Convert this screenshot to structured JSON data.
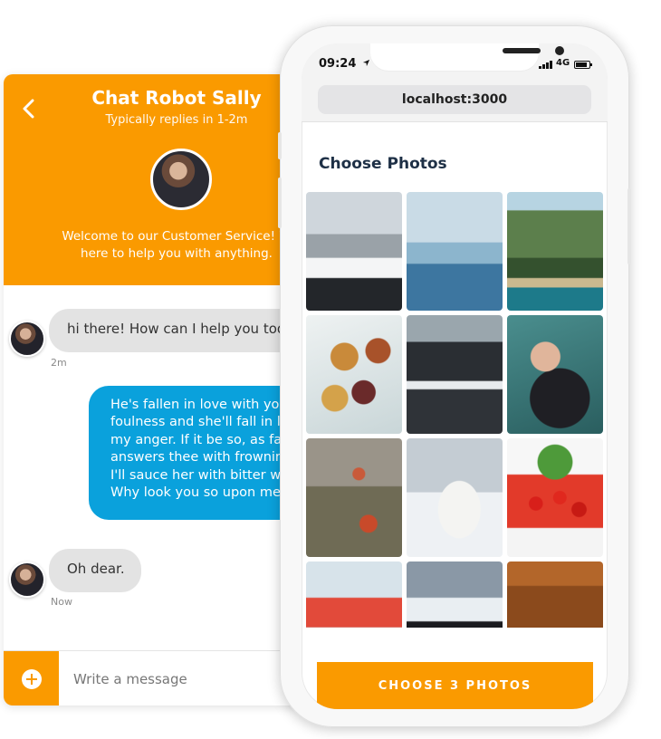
{
  "chat": {
    "title": "Chat Robot Sally",
    "subtitle": "Typically replies in 1-2m",
    "welcome": "Welcome to our Customer Service! W\nhere to help you with anything.",
    "messages": [
      {
        "from": "bot",
        "text": "hi there! How can I help you toda",
        "time": "2m"
      },
      {
        "from": "user",
        "text": "He's fallen in love with you\nfoulness and she'll fall in l\nmy anger. If it be so, as fas\nanswers thee with frownin\nI'll sauce her with bitter w\nWhy look you so upon me"
      },
      {
        "from": "bot",
        "text": "Oh dear.",
        "time": "Now"
      }
    ],
    "composer": {
      "placeholder": "Write a message"
    }
  },
  "phone": {
    "status": {
      "time": "09:24",
      "network": "4G"
    },
    "url": "localhost:3000",
    "heading": "Choose Photos",
    "photos": [
      "white sports car",
      "man on boat",
      "green mountain coast",
      "pastries and figs",
      "black sand beach",
      "woman with sunglasses",
      "red flowers",
      "snowy owl",
      "red currants",
      "red bicycle",
      "penguins",
      "wooden door"
    ],
    "cta_label": "CHOOSE 3 PHOTOS"
  },
  "colors": {
    "accent": "#fa9a00",
    "user_bubble": "#0aa1dc",
    "bot_bubble": "#e3e3e3"
  }
}
